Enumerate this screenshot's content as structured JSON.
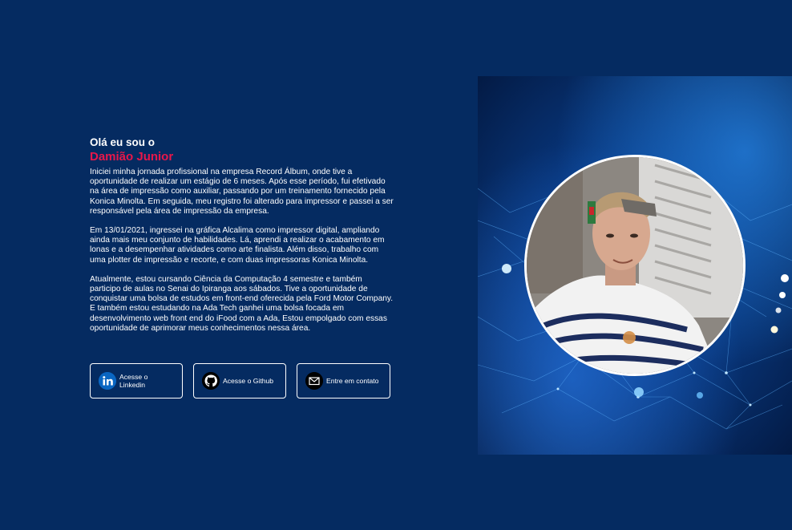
{
  "intro": {
    "greeting": "Olá eu sou o",
    "name": "Damião Junior",
    "paragraphs": [
      "Iniciei minha jornada profissional na empresa Record Álbum, onde tive a oportunidade de realizar um estágio de 6 meses. Após esse período, fui efetivado na área de impressão como auxiliar, passando por um treinamento fornecido pela Konica Minolta. Em seguida, meu registro foi alterado para impressor e passei a ser responsável pela área de impressão da empresa.",
      "Em 13/01/2021, ingressei na gráfica Alcalima como impressor digital, ampliando ainda mais meu conjunto de habilidades. Lá, aprendi a realizar o acabamento em lonas e a desempenhar atividades como arte finalista. Além disso, trabalho com uma plotter de impressão e recorte, e com duas impressoras Konica Minolta.",
      "Atualmente, estou cursando Ciência da Computação 4 semestre e também participo de aulas no Senai do Ipiranga aos sábados. Tive a oportunidade de conquistar uma bolsa de estudos em front-end oferecida pela Ford Motor Company. E também estou estudando na Ada Tech ganhei uma bolsa focada em desenvolvimento web front end do iFood com a Ada, Estou empolgado com essas oportunidade de aprimorar meus conhecimentos nessa área."
    ]
  },
  "buttons": {
    "linkedin": {
      "label": "Acesse o Linkedin",
      "icon": "linkedin-icon"
    },
    "github": {
      "label": "Acesse o Github",
      "icon": "github-icon"
    },
    "contact": {
      "label": "Entre em contato",
      "icon": "mail-icon"
    }
  },
  "colors": {
    "background": "#052b61",
    "accent_name": "#e8174a",
    "linkedin_blue": "#0a66c2"
  }
}
